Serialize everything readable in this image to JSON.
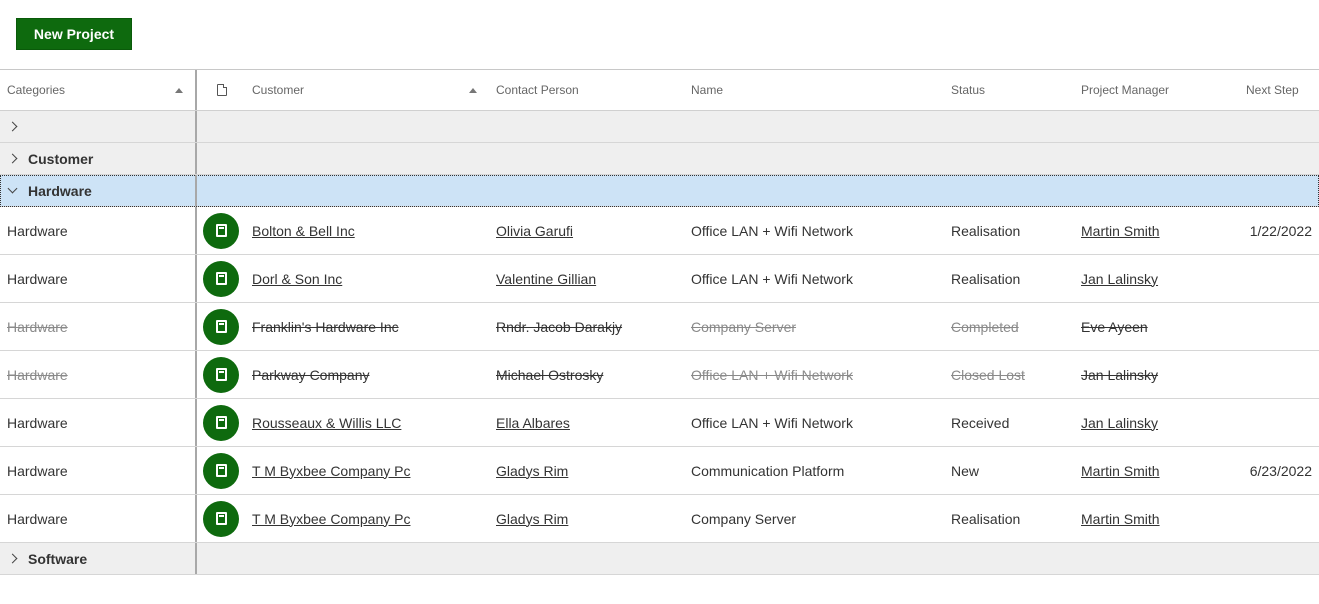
{
  "toolbar": {
    "new_project_label": "New Project"
  },
  "colors": {
    "accent": "#0e6a0e",
    "selected_group": "#cde3f6",
    "group_bg": "#efefef"
  },
  "header": {
    "categories": "Categories",
    "type_icon": "document-icon",
    "customer": "Customer",
    "contact_person": "Contact Person",
    "name": "Name",
    "status": "Status",
    "project_manager": "Project Manager",
    "next_step": "Next Step"
  },
  "groups": [
    {
      "label": "",
      "expanded": false
    },
    {
      "label": "Customer",
      "expanded": false
    },
    {
      "label": "Hardware",
      "expanded": true,
      "selected": true
    },
    {
      "label": "Software",
      "expanded": false
    }
  ],
  "rows": [
    {
      "category": "Hardware",
      "icon": "book-icon",
      "customer": "Bolton & Bell Inc",
      "contact": "Olivia Garufi",
      "name": "Office LAN + Wifi Network",
      "status": "Realisation",
      "manager": "Martin Smith",
      "next_step": "1/22/2022",
      "closed": false
    },
    {
      "category": "Hardware",
      "icon": "book-icon",
      "customer": "Dorl & Son Inc",
      "contact": "Valentine Gillian",
      "name": "Office LAN + Wifi Network",
      "status": "Realisation",
      "manager": "Jan Lalinsky",
      "next_step": "",
      "closed": false
    },
    {
      "category": "Hardware",
      "icon": "book-icon",
      "customer": "Franklin's Hardware Inc",
      "contact": "Rndr. Jacob Darakjy",
      "name": "Company Server",
      "status": "Completed",
      "manager": "Eve Ayeen",
      "next_step": "",
      "closed": true
    },
    {
      "category": "Hardware",
      "icon": "book-icon",
      "customer": "Parkway Company",
      "contact": "Michael Ostrosky",
      "name": "Office LAN + Wifi Network",
      "status": "Closed Lost",
      "manager": "Jan Lalinsky",
      "next_step": "",
      "closed": true
    },
    {
      "category": "Hardware",
      "icon": "book-icon",
      "customer": "Rousseaux & Willis LLC",
      "contact": "Ella Albares",
      "name": "Office LAN + Wifi Network",
      "status": "Received",
      "manager": "Jan Lalinsky",
      "next_step": "",
      "closed": false
    },
    {
      "category": "Hardware",
      "icon": "book-icon",
      "customer": "T M Byxbee Company Pc",
      "contact": "Gladys Rim",
      "name": "Communication Platform",
      "status": "New",
      "manager": "Martin Smith",
      "next_step": "6/23/2022",
      "closed": false
    },
    {
      "category": "Hardware",
      "icon": "book-icon",
      "customer": "T M Byxbee Company Pc",
      "contact": "Gladys Rim",
      "name": "Company Server",
      "status": "Realisation",
      "manager": "Martin Smith",
      "next_step": "",
      "closed": false
    }
  ]
}
